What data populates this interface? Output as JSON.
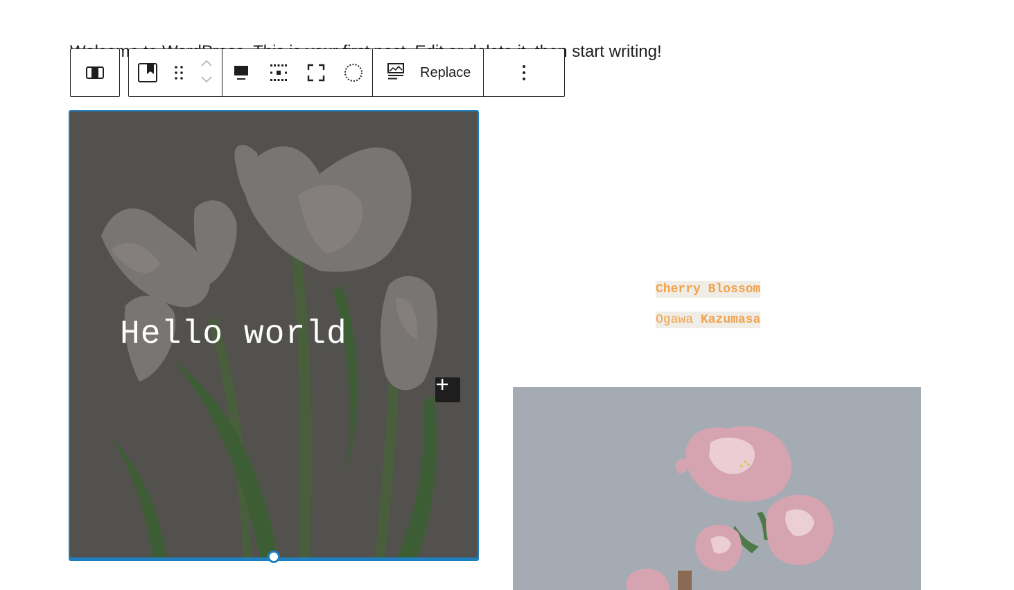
{
  "intro_text": "Welcome to WordPress. This is your first post. Edit or delete it, then start writing!",
  "toolbar": {
    "parent_icon": "columns-icon",
    "block_icon": "cover-block-icon",
    "drag_icon": "drag-handle-icon",
    "move_up_icon": "chevron-up-icon",
    "move_down_icon": "chevron-down-icon",
    "align_icon": "content-position-icon",
    "position_icon": "matrix-position-icon",
    "fullheight_icon": "full-height-icon",
    "duotone_icon": "duotone-circle-icon",
    "replace_icon": "media-replace-icon",
    "replace_label": "Replace",
    "more_icon": "more-options-icon"
  },
  "cover": {
    "title": "Hello world",
    "add_block_icon": "plus-icon",
    "overlay_color": "#3c3a38",
    "selection_color": "#1f7fbf"
  },
  "caption": {
    "title": "Cherry Blossom",
    "author_first": "Ogawa",
    "author_last": "Kazumasa",
    "text_color": "#f1a34b",
    "highlight_color": "#f0ece6"
  },
  "side_image": {
    "subject": "cherry-blossom-illustration",
    "background_color": "#a4aab1"
  }
}
